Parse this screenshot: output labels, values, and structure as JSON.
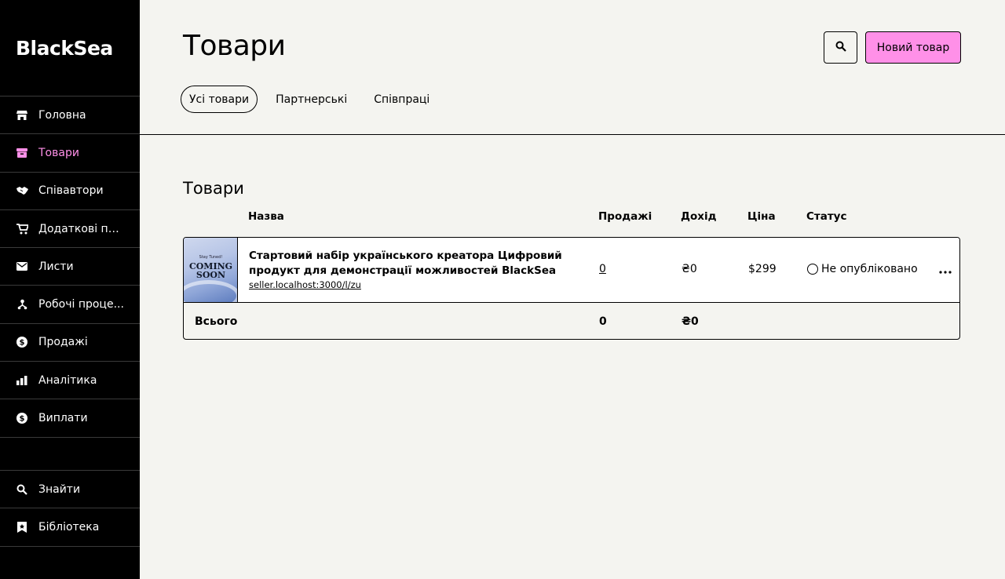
{
  "sidebar": {
    "logo": "BlackSea",
    "items": [
      {
        "label": "Головна",
        "icon": "store-icon"
      },
      {
        "label": "Товари",
        "icon": "archive-icon",
        "active": true
      },
      {
        "label": "Співавтори",
        "icon": "handshake-icon"
      },
      {
        "label": "Додаткові пр...",
        "icon": "cart-icon"
      },
      {
        "label": "Листи",
        "icon": "envelope-icon"
      },
      {
        "label": "Робочі проце...",
        "icon": "workflow-icon"
      },
      {
        "label": "Продажі",
        "icon": "dollar-circle-icon"
      },
      {
        "label": "Аналітика",
        "icon": "bar-chart-icon"
      },
      {
        "label": "Виплати",
        "icon": "dollar-circle-icon"
      }
    ],
    "bottom_items": [
      {
        "label": "Знайти",
        "icon": "search-icon"
      },
      {
        "label": "Бібліотека",
        "icon": "bookmark-icon"
      }
    ],
    "active_color": "#ff90e8"
  },
  "header": {
    "title": "Товари",
    "new_button": "Новий товар",
    "accent": "#ff90e8",
    "tabs": [
      {
        "label": "Усі товари",
        "active": true
      },
      {
        "label": "Партнерські"
      },
      {
        "label": "Співпраці"
      }
    ]
  },
  "products": {
    "section_title": "Товари",
    "columns": {
      "name": "Назва",
      "sales": "Продажі",
      "revenue": "Дохід",
      "price": "Ціна",
      "status": "Статус"
    },
    "rows": [
      {
        "name": "Стартовий набір українського креатора Цифровий продукт для демонстрації можливостей BlackSea",
        "url": "seller.localhost:3000/l/zu",
        "sales": "0",
        "revenue": "₴0",
        "price": "$299",
        "status": "Не опубліковано",
        "thumb_small": "Stay Tuned!",
        "thumb_big": "COMING SOON"
      }
    ],
    "total": {
      "label": "Всього",
      "sales": "0",
      "revenue": "₴0"
    }
  }
}
